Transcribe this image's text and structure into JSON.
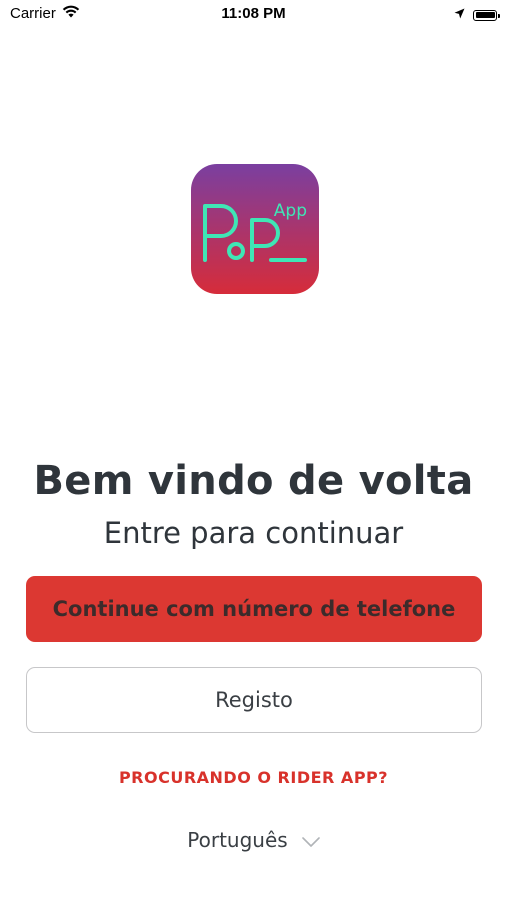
{
  "status_bar": {
    "carrier": "Carrier",
    "time": "11:08 PM",
    "battery_level": 1.0
  },
  "logo": {
    "main_text": "PoP",
    "sub_text": "App"
  },
  "welcome": {
    "title": "Bem vindo de volta",
    "subtitle": "Entre para continuar"
  },
  "buttons": {
    "phone_label": "Continue com número de telefone",
    "register_label": "Registo"
  },
  "rider_link": "PROCURANDO O RIDER APP?",
  "language": {
    "selected": "Português"
  },
  "colors": {
    "primary": "#dc3832",
    "link": "#d8322b",
    "logo_text": "#3fe6b5",
    "logo_gradient_top": "#7a3fa0",
    "logo_gradient_bottom": "#d62c3a"
  }
}
